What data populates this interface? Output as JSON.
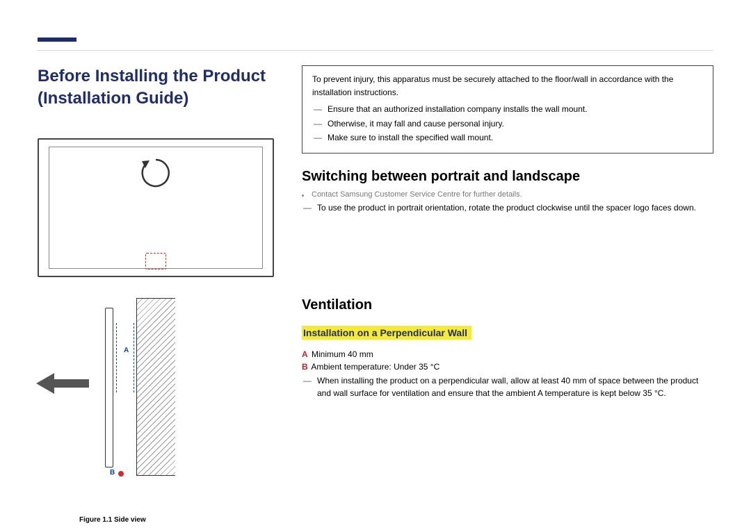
{
  "leftCol": {
    "title": "Before Installing the Product (Installation Guide)",
    "figureCaption": "Figure 1.1 Side view"
  },
  "noteBox": {
    "lead": "To prevent injury, this apparatus must be securely attached to the floor/wall in accordance with the installation instructions.",
    "items": [
      "Ensure that an authorized installation company installs the wall mount.",
      "Otherwise, it may fall and cause personal injury.",
      "Make sure to install the specified wall mount."
    ]
  },
  "switching": {
    "title": "Switching between portrait and landscape",
    "contact": "Contact Samsung Customer Service Centre for further details.",
    "note": "To use the product in portrait orientation, rotate the product clockwise until the spacer logo faces down."
  },
  "ventilation": {
    "title": "Ventilation",
    "subTitle": "Installation on a Perpendicular Wall",
    "specA": {
      "letter": "A",
      "text": "Minimum 40 mm"
    },
    "specB": {
      "letter": "B",
      "text": "Ambient temperature: Under 35 °C"
    },
    "note": "When installing the product on a perpendicular wall, allow at least 40 mm of space between the product and wall surface for ventilation and ensure that the ambient A temperature is kept below 35 °C."
  }
}
